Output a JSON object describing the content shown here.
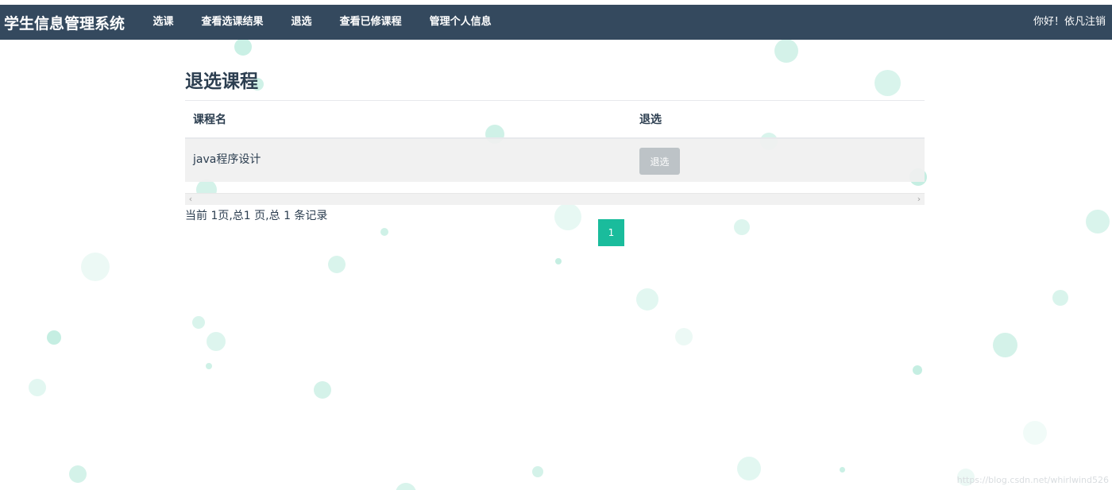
{
  "navbar": {
    "brand": "学生信息管理系统",
    "items": [
      {
        "label": "选课"
      },
      {
        "label": "查看选课结果"
      },
      {
        "label": "退选"
      },
      {
        "label": "查看已修课程"
      },
      {
        "label": "管理个人信息"
      }
    ],
    "greeting": "你好！依凡",
    "logout": "注销"
  },
  "main": {
    "title": "退选课程",
    "table": {
      "headers": [
        "课程名",
        "退选"
      ],
      "rows": [
        {
          "course_name": "java程序设计",
          "action_label": "退选"
        }
      ]
    },
    "pagination": {
      "info": "当前 1页,总1 页,总 1 条记录",
      "pages": [
        "1"
      ],
      "current": "1"
    }
  },
  "watermark": "https://blog.csdn.net/whirlwind526",
  "colors": {
    "navbar_bg": "#34495e",
    "accent": "#1abc9c",
    "button_disabled": "#bdc3c7",
    "bubble": "#9fe3cf"
  },
  "icons": {
    "scroll_left": "chevron-left-icon",
    "scroll_right": "chevron-right-icon"
  }
}
